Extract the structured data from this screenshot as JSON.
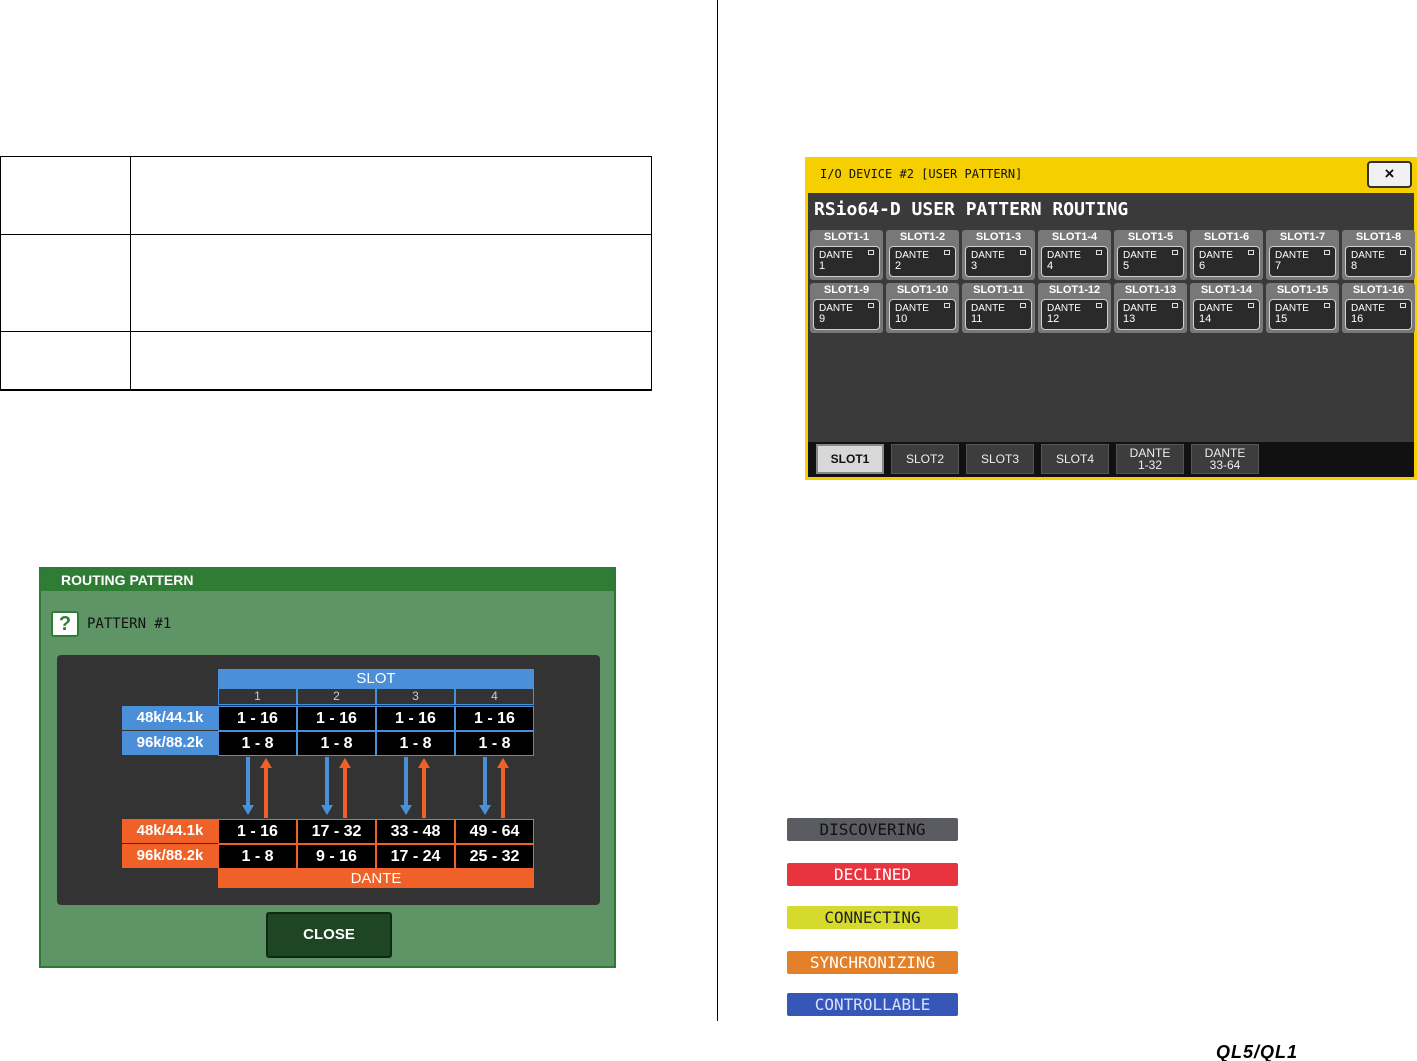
{
  "routing_pattern": {
    "title": "ROUTING PATTERN",
    "help_icon": "?",
    "pattern_label": "PATTERN #1",
    "slot_header": "SLOT",
    "slot_numbers": [
      "1",
      "2",
      "3",
      "4"
    ],
    "slot_rates": [
      "48k/44.1k",
      "96k/88.2k"
    ],
    "slot_rows": [
      [
        "1 - 16",
        "1 - 16",
        "1 - 16",
        "1 - 16"
      ],
      [
        "1 - 8",
        "1 - 8",
        "1 - 8",
        "1 - 8"
      ]
    ],
    "dante_rates": [
      "48k/44.1k",
      "96k/88.2k"
    ],
    "dante_rows": [
      [
        "1 - 16",
        "17 - 32",
        "33 - 48",
        "49 - 64"
      ],
      [
        "1 - 8",
        "9 - 16",
        "17 - 24",
        "25 - 32"
      ]
    ],
    "dante_footer": "DANTE",
    "close_label": "CLOSE",
    "colors": {
      "slot_blue": "#4a8fd8",
      "dante_orange": "#ef6126",
      "window_green": "#5f9466"
    }
  },
  "user_pattern": {
    "title": "I/O DEVICE #2 [USER PATTERN]",
    "close_icon": "×",
    "heading": "RSio64-D USER PATTERN ROUTING",
    "slots": [
      {
        "name": "SLOT1-1",
        "label": "DANTE",
        "num": "1"
      },
      {
        "name": "SLOT1-2",
        "label": "DANTE",
        "num": "2"
      },
      {
        "name": "SLOT1-3",
        "label": "DANTE",
        "num": "3"
      },
      {
        "name": "SLOT1-4",
        "label": "DANTE",
        "num": "4"
      },
      {
        "name": "SLOT1-5",
        "label": "DANTE",
        "num": "5"
      },
      {
        "name": "SLOT1-6",
        "label": "DANTE",
        "num": "6"
      },
      {
        "name": "SLOT1-7",
        "label": "DANTE",
        "num": "7"
      },
      {
        "name": "SLOT1-8",
        "label": "DANTE",
        "num": "8"
      },
      {
        "name": "SLOT1-9",
        "label": "DANTE",
        "num": "9"
      },
      {
        "name": "SLOT1-10",
        "label": "DANTE",
        "num": "10"
      },
      {
        "name": "SLOT1-11",
        "label": "DANTE",
        "num": "11"
      },
      {
        "name": "SLOT1-12",
        "label": "DANTE",
        "num": "12"
      },
      {
        "name": "SLOT1-13",
        "label": "DANTE",
        "num": "13"
      },
      {
        "name": "SLOT1-14",
        "label": "DANTE",
        "num": "14"
      },
      {
        "name": "SLOT1-15",
        "label": "DANTE",
        "num": "15"
      },
      {
        "name": "SLOT1-16",
        "label": "DANTE",
        "num": "16"
      }
    ],
    "tabs": [
      {
        "label": "SLOT1",
        "active": true
      },
      {
        "label": "SLOT2",
        "active": false
      },
      {
        "label": "SLOT3",
        "active": false
      },
      {
        "label": "SLOT4",
        "active": false
      },
      {
        "label": "DANTE\n1-32",
        "active": false
      },
      {
        "label": "DANTE\n33-64",
        "active": false
      }
    ]
  },
  "status_badges": [
    {
      "label": "DISCOVERING",
      "bg": "#5a5c62",
      "fg": "#111111"
    },
    {
      "label": "DECLINED",
      "bg": "#e8343f",
      "fg": "#ffffff"
    },
    {
      "label": "CONNECTING",
      "bg": "#d6da2c",
      "fg": "#222222"
    },
    {
      "label": "SYNCHRONIZING",
      "bg": "#e3802a",
      "fg": "#ffffff"
    },
    {
      "label": "CONTROLLABLE",
      "bg": "#3657b8",
      "fg": "#d8e0ff"
    }
  ],
  "footer": {
    "brand": "QL5/QL1"
  }
}
